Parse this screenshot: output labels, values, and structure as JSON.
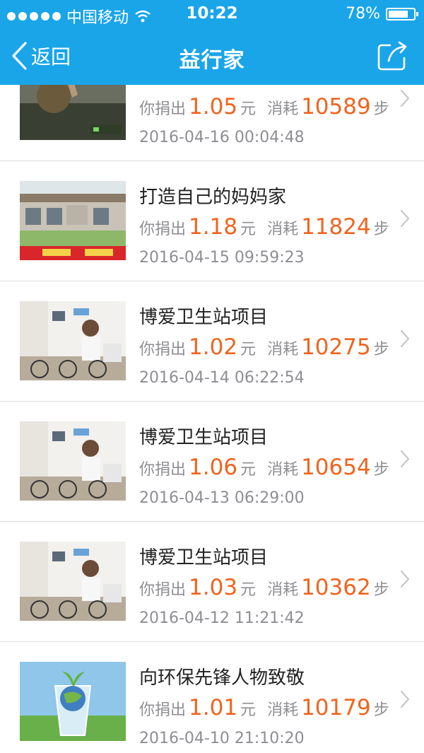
{
  "status": {
    "carrier": "中国移动",
    "time": "10:22",
    "battery": "78%",
    "battery_level": 0.78
  },
  "nav": {
    "back_label": "返回",
    "title": "益行家",
    "share_icon": "share-icon"
  },
  "labels": {
    "donate_prefix": "你捐出",
    "currency": "元",
    "consume_prefix": "消耗",
    "steps_unit": "步"
  },
  "items": [
    {
      "title": "",
      "amount": "1.05",
      "steps": "10589",
      "date": "2016-04-16 00:04:48",
      "thumb": "volunteer-photo"
    },
    {
      "title": "打造自己的妈妈家",
      "amount": "1.18",
      "steps": "11824",
      "date": "2016-04-15 09:59:23",
      "thumb": "community-center-photo"
    },
    {
      "title": "博爱卫生站项目",
      "amount": "1.02",
      "steps": "10275",
      "date": "2016-04-14 06:22:54",
      "thumb": "health-station-photo"
    },
    {
      "title": "博爱卫生站项目",
      "amount": "1.06",
      "steps": "10654",
      "date": "2016-04-13 06:29:00",
      "thumb": "health-station-photo"
    },
    {
      "title": "博爱卫生站项目",
      "amount": "1.03",
      "steps": "10362",
      "date": "2016-04-12 11:21:42",
      "thumb": "health-station-photo"
    },
    {
      "title": "向环保先锋人物致敬",
      "amount": "1.01",
      "steps": "10179",
      "date": "2016-04-10 21:10:20",
      "thumb": "eco-glass-photo"
    }
  ]
}
